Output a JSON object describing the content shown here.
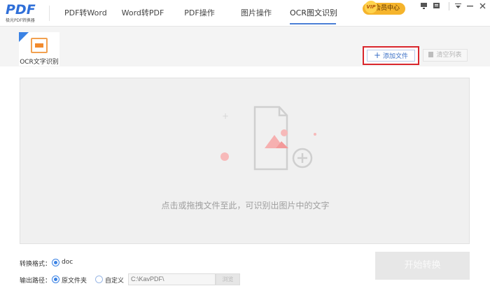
{
  "app": {
    "logo_text": "PDF",
    "logo_subtext": "极光PDF转换器"
  },
  "nav": {
    "items": [
      {
        "label": "PDF转Word"
      },
      {
        "label": "Word转PDF"
      },
      {
        "label": "PDF操作"
      },
      {
        "label": "图片操作"
      },
      {
        "label": "OCR图文识别",
        "active": true
      }
    ]
  },
  "header": {
    "vip_label": "会员中心",
    "vip_badge": "VIP"
  },
  "tool": {
    "label": "OCR文字识别"
  },
  "actions": {
    "add_file": "添加文件",
    "clear_list": "清空列表"
  },
  "dropzone": {
    "hint": "点击或拖拽文件至此，可识别出图片中的文字"
  },
  "settings": {
    "format_label": "转换格式：",
    "format_value": "doc",
    "output_label": "输出路径：",
    "output_original": "原文件夹",
    "output_custom": "自定义",
    "output_path": "C:\\KavPDF\\",
    "browse_label": "浏览"
  },
  "start_button": "开始转换",
  "colors": {
    "accent": "#3a82e4",
    "highlight_border": "#d9262c",
    "vip": "#f5b42c"
  }
}
